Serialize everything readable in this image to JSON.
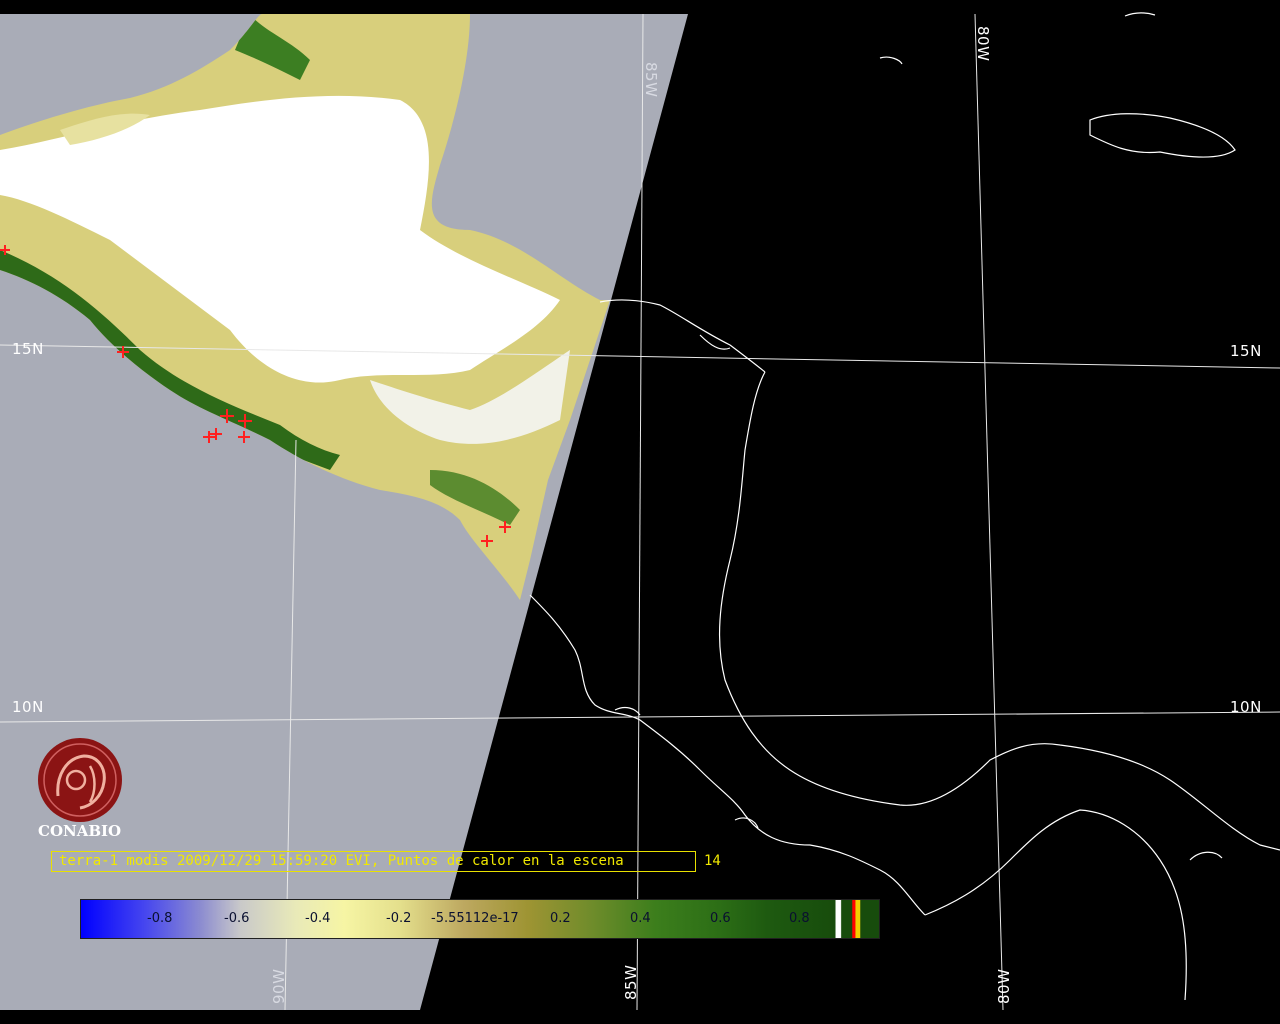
{
  "caption": {
    "text": "terra-1 modis 2009/12/29 15:59:20 EVI, Puntos de calor en la escena",
    "hotspot_count": "14"
  },
  "grid_labels": {
    "lat_15_left": "15N",
    "lat_15_right": "15N",
    "lat_10_left": "10N",
    "lat_10_right": "10N",
    "lon_85_top": "85W",
    "lon_80_top": "80W",
    "lon_90_bottom": "90W",
    "lon_85_bottom": "85W",
    "lon_80_bottom": "80W"
  },
  "colorbar": {
    "ticks": [
      "-0.8",
      "-0.6",
      "-0.4",
      "-0.2",
      "-5.55112e-17",
      "0.2",
      "0.4",
      "0.6",
      "0.8"
    ]
  },
  "logo": {
    "text": "CONABIO",
    "icon": "conabio-logo-icon"
  },
  "colors": {
    "background": "#000000",
    "no_data": "#a9acb7",
    "cloud": "#ffffff",
    "vegetation_high": "#2e6a18",
    "vegetation_low": "#e8e29a",
    "hotspot": "#ff2020",
    "caption": "#f0e800"
  }
}
